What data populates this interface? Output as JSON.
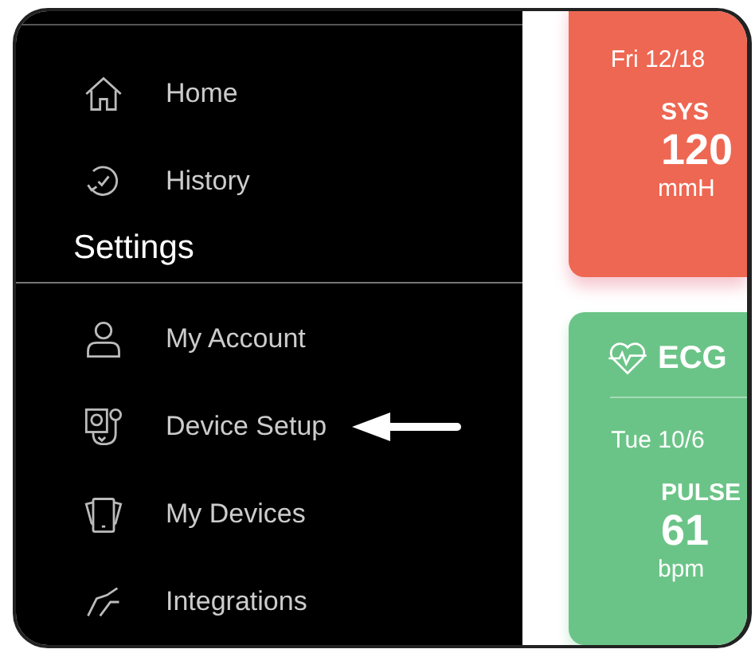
{
  "sidebar": {
    "items": [
      {
        "label": "Home",
        "kind": "home"
      },
      {
        "label": "History",
        "kind": "history"
      }
    ],
    "section": "Settings",
    "settings_items": [
      {
        "label": "My Account",
        "kind": "account"
      },
      {
        "label": "Device Setup",
        "kind": "device"
      },
      {
        "label": "My Devices",
        "kind": "devices"
      },
      {
        "label": "Integrations",
        "kind": "integrations"
      }
    ]
  },
  "cards": [
    {
      "kind": "bp",
      "date": "Fri 12/18",
      "metric": "SYS",
      "value": "120",
      "unit": "mmH",
      "color": "#ee6752"
    },
    {
      "kind": "ecg",
      "title": "ECG",
      "date": "Tue 10/6",
      "metric": "PULSE",
      "value": "61",
      "unit": "bpm",
      "color": "#6bc487"
    }
  ]
}
